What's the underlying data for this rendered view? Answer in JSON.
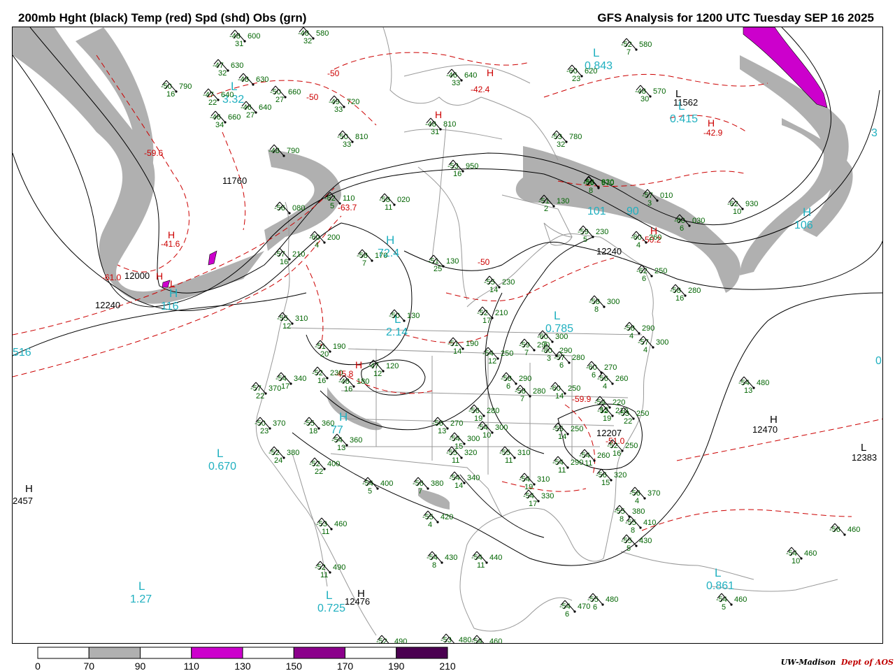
{
  "title_left": "200mb Hght (black) Temp (red) Spd (shd) Obs (grn)",
  "title_right": "GFS Analysis for 1200 UTC Tuesday  SEP 16 2025",
  "credit": {
    "org": "UW-Madison",
    "dept": "Dept of AOS"
  },
  "colors": {
    "height": "#000000",
    "temp": "#cc0000",
    "obs": "#006400",
    "speed_label": "#20b0c0",
    "shade_70": "#b0b0b0",
    "shade_110": "#cc00cc",
    "shade_150": "#8b008b",
    "shade_190": "#4b0050",
    "geography": "#999999"
  },
  "colorbar": {
    "ticks": [
      "0",
      "70",
      "90",
      "110",
      "130",
      "150",
      "170",
      "190",
      "210"
    ],
    "fills": [
      "#ffffff",
      "#b0b0b0",
      "#ffffff",
      "#cc00cc",
      "#ffffff",
      "#8b008b",
      "#ffffff",
      "#4b0050"
    ]
  },
  "height_labels": [
    "11760",
    "12000",
    "12240",
    "11562",
    "12240",
    "12207",
    "12470",
    "12383",
    "2457",
    "12476"
  ],
  "height_centers": [
    {
      "mark": "H",
      "value": "2457"
    },
    {
      "mark": "H",
      "value": "12476"
    },
    {
      "mark": "H",
      "value": "12470"
    },
    {
      "mark": "L",
      "value": "12383"
    },
    {
      "mark": "L",
      "value": "11562"
    }
  ],
  "temp_labels": [
    "-50",
    "-50",
    "-42.4",
    "-42.9",
    "-59.6",
    "-63.7",
    "-41.6",
    "-61.0",
    "-50",
    "-45.8",
    "-59.9",
    "-51.0",
    "-50.2"
  ],
  "temp_marks": [
    "H",
    "H",
    "H",
    "H",
    "H",
    "H",
    "H",
    "L"
  ],
  "speed_centers": [
    {
      "mark": "L",
      "value": "0.843"
    },
    {
      "mark": "L",
      "value": "0.415"
    },
    {
      "mark": "L",
      "value": "3.32"
    },
    {
      "mark": "H",
      "value": "72.4"
    },
    {
      "mark": "",
      "value": "101"
    },
    {
      "mark": "",
      "value": "90"
    },
    {
      "mark": "H",
      "value": "106"
    },
    {
      "mark": "H",
      "value": "116"
    },
    {
      "mark": "L",
      "value": "2.14"
    },
    {
      "mark": "L",
      "value": "0.785"
    },
    {
      "mark": "H",
      "value": "77"
    },
    {
      "mark": "L",
      "value": "0.670"
    },
    {
      "mark": "L",
      "value": "1.27"
    },
    {
      "mark": "L",
      "value": "0.725"
    },
    {
      "mark": "L",
      "value": "0.861"
    },
    {
      "mark": "",
      "value": "516"
    },
    {
      "mark": "",
      "value": "3"
    },
    {
      "mark": "",
      "value": "0"
    }
  ],
  "obs": [
    {
      "t": "-48",
      "h": "600",
      "d": "31"
    },
    {
      "t": "-48",
      "h": "580",
      "d": "32"
    },
    {
      "t": "-47",
      "h": "630",
      "d": "32"
    },
    {
      "t": "-48",
      "h": "630",
      "d": ""
    },
    {
      "t": "-50",
      "h": "790",
      "d": "16"
    },
    {
      "t": "-47",
      "h": "640",
      "d": "22"
    },
    {
      "t": "-46",
      "h": "640",
      "d": "27"
    },
    {
      "t": "-50",
      "h": "660",
      "d": "27"
    },
    {
      "t": "-46",
      "h": "660",
      "d": "34"
    },
    {
      "t": "-49",
      "h": "720",
      "d": "33"
    },
    {
      "t": "-52",
      "h": "580",
      "d": "7"
    },
    {
      "t": "-60",
      "h": "620",
      "d": "23"
    },
    {
      "t": "-48",
      "h": "570",
      "d": "30"
    },
    {
      "t": "-46",
      "h": "640",
      "d": "33"
    },
    {
      "t": "-48",
      "h": "810",
      "d": "31"
    },
    {
      "t": "-50",
      "h": "810",
      "d": "33"
    },
    {
      "t": "-53",
      "h": "780",
      "d": "32"
    },
    {
      "t": "-48",
      "h": "790",
      "d": ""
    },
    {
      "t": "-58",
      "h": "830",
      "d": ""
    },
    {
      "t": "-53",
      "h": "950",
      "d": "16"
    },
    {
      "t": "-59",
      "h": "970",
      "d": "8"
    },
    {
      "t": "-57",
      "h": "010",
      "d": "3"
    },
    {
      "t": "-62",
      "h": "930",
      "d": "10"
    },
    {
      "t": "-60",
      "h": "030",
      "d": "6"
    },
    {
      "t": "-62",
      "h": "110",
      "d": "5"
    },
    {
      "t": "-58",
      "h": "020",
      "d": "11"
    },
    {
      "t": "-56",
      "h": "080",
      "d": ""
    },
    {
      "t": "-51",
      "h": "130",
      "d": "2"
    },
    {
      "t": "-59",
      "h": "230",
      "d": "5"
    },
    {
      "t": "-60",
      "h": "200",
      "d": "4"
    },
    {
      "t": "-58",
      "h": "170",
      "d": "7"
    },
    {
      "t": "-51",
      "h": "130",
      "d": "25"
    },
    {
      "t": "-60",
      "h": "260",
      "d": "4"
    },
    {
      "t": "-57",
      "h": "210",
      "d": "16"
    },
    {
      "t": "-62",
      "h": "250",
      "d": "6"
    },
    {
      "t": "-55",
      "h": "230",
      "d": "14"
    },
    {
      "t": "-58",
      "h": "280",
      "d": "16"
    },
    {
      "t": "-58",
      "h": "300",
      "d": "8"
    },
    {
      "t": "-55",
      "h": "310",
      "d": "12"
    },
    {
      "t": "-50",
      "h": "130",
      "d": ""
    },
    {
      "t": "-52",
      "h": "210",
      "d": "17"
    },
    {
      "t": "-58",
      "h": "290",
      "d": "4"
    },
    {
      "t": "-57",
      "h": "300",
      "d": "4"
    },
    {
      "t": "-51",
      "h": "190",
      "d": "20"
    },
    {
      "t": "-51",
      "h": "190",
      "d": "14"
    },
    {
      "t": "-54",
      "h": "250",
      "d": "12"
    },
    {
      "t": "-59",
      "h": "290",
      "d": "7"
    },
    {
      "t": "-60",
      "h": "300",
      "d": "7"
    },
    {
      "t": "-57",
      "h": "280",
      "d": "6"
    },
    {
      "t": "-47",
      "h": "120",
      "d": "12"
    },
    {
      "t": "-80",
      "h": "290",
      "d": "3"
    },
    {
      "t": "-60",
      "h": "270",
      "d": "6"
    },
    {
      "t": "-54",
      "h": "340",
      "d": "17"
    },
    {
      "t": "-52",
      "h": "230",
      "d": "16"
    },
    {
      "t": "-48",
      "h": "180",
      "d": "16"
    },
    {
      "t": "-56",
      "h": "260",
      "d": "4"
    },
    {
      "t": "-54",
      "h": "480",
      "d": "13"
    },
    {
      "t": "-57",
      "h": "370",
      "d": "22"
    },
    {
      "t": "-58",
      "h": "290",
      "d": "6"
    },
    {
      "t": "-58",
      "h": "280",
      "d": "7"
    },
    {
      "t": "-60",
      "h": "250",
      "d": "14"
    },
    {
      "t": "-54",
      "h": "220",
      "d": "15"
    },
    {
      "t": "-52",
      "h": "210",
      "d": "19"
    },
    {
      "t": "-53",
      "h": "250",
      "d": "22"
    },
    {
      "t": "-50",
      "h": "370",
      "d": "23"
    },
    {
      "t": "-55",
      "h": "360",
      "d": "18"
    },
    {
      "t": "-56",
      "h": "270",
      "d": "13"
    },
    {
      "t": "-56",
      "h": "280",
      "d": "19"
    },
    {
      "t": "-54",
      "h": "300",
      "d": "10"
    },
    {
      "t": "-55",
      "h": "250",
      "d": "14"
    },
    {
      "t": "-52",
      "h": "250",
      "d": "16"
    },
    {
      "t": "-54",
      "h": "360",
      "d": "13"
    },
    {
      "t": "-54",
      "h": "300",
      "d": "15"
    },
    {
      "t": "-55",
      "h": "320",
      "d": "11"
    },
    {
      "t": "-55",
      "h": "310",
      "d": "11"
    },
    {
      "t": "-54",
      "h": "290",
      "d": "11"
    },
    {
      "t": "-54",
      "h": "260",
      "d": "11"
    },
    {
      "t": "-52",
      "h": "380",
      "d": "24"
    },
    {
      "t": "-52",
      "h": "400",
      "d": "22"
    },
    {
      "t": "-54",
      "h": "340",
      "d": "14"
    },
    {
      "t": "-56",
      "h": "320",
      "d": "15"
    },
    {
      "t": "-54",
      "h": "310",
      "d": "19"
    },
    {
      "t": "-54",
      "h": "400",
      "d": "5"
    },
    {
      "t": "-56",
      "h": "380",
      "d": "7"
    },
    {
      "t": "-54",
      "h": "330",
      "d": "17"
    },
    {
      "t": "-56",
      "h": "370",
      "d": "4"
    },
    {
      "t": "-55",
      "h": "420",
      "d": "4"
    },
    {
      "t": "-55",
      "h": "380",
      "d": "8"
    },
    {
      "t": "-55",
      "h": "410",
      "d": "8"
    },
    {
      "t": "-56",
      "h": "460",
      "d": ""
    },
    {
      "t": "-53",
      "h": "460",
      "d": "11"
    },
    {
      "t": "-55",
      "h": "430",
      "d": "5"
    },
    {
      "t": "-54",
      "h": "460",
      "d": "10"
    },
    {
      "t": "-54",
      "h": "430",
      "d": "8"
    },
    {
      "t": "-54",
      "h": "440",
      "d": "11"
    },
    {
      "t": "-52",
      "h": "490",
      "d": "11"
    },
    {
      "t": "-55",
      "h": "480",
      "d": "6"
    },
    {
      "t": "-54",
      "h": "470",
      "d": "6"
    },
    {
      "t": "-54",
      "h": "460",
      "d": "5"
    },
    {
      "t": "-52",
      "h": "490",
      "d": ""
    },
    {
      "t": "-53",
      "h": "480",
      "d": ""
    },
    {
      "t": "-54",
      "h": "460",
      "d": ""
    }
  ]
}
